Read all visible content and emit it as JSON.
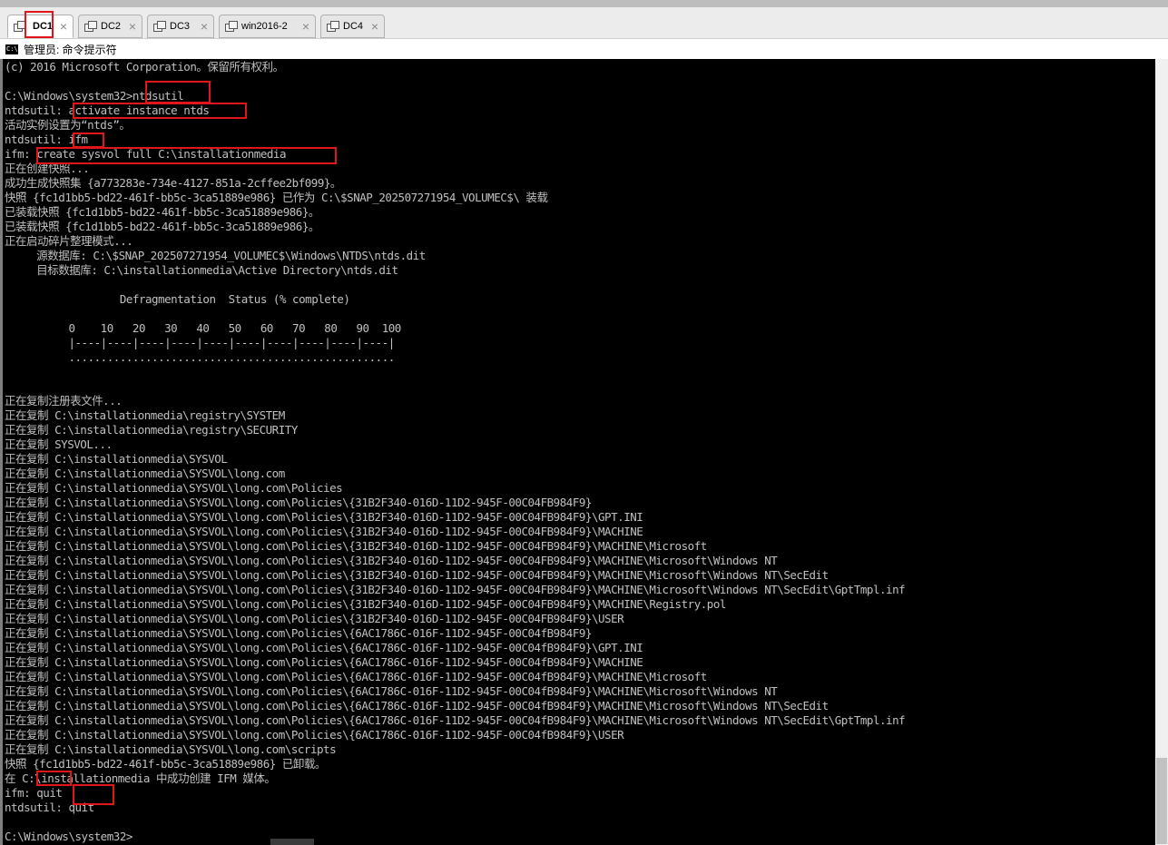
{
  "tabs": [
    {
      "label": "DC1",
      "active": true
    },
    {
      "label": "DC2",
      "active": false
    },
    {
      "label": "DC3",
      "active": false
    },
    {
      "label": "win2016-2",
      "active": false
    },
    {
      "label": "DC4",
      "active": false
    }
  ],
  "close_glyph": "×",
  "window": {
    "title": "管理员: 命令提示符",
    "icon_text": "C:\\"
  },
  "console_lines": [
    "(c) 2016 Microsoft Corporation。保留所有权利。",
    "",
    "C:\\Windows\\system32>ntdsutil",
    "ntdsutil: activate instance ntds",
    "活动实例设置为“ntds”。",
    "ntdsutil: ifm",
    "ifm: create sysvol full C:\\installationmedia",
    "正在创建快照...",
    "成功生成快照集 {a773283e-734e-4127-851a-2cffee2bf099}。",
    "快照 {fc1d1bb5-bd22-461f-bb5c-3ca51889e986} 已作为 C:\\$SNAP_202507271954_VOLUMEC$\\ 装载",
    "已装载快照 {fc1d1bb5-bd22-461f-bb5c-3ca51889e986}。",
    "已装载快照 {fc1d1bb5-bd22-461f-bb5c-3ca51889e986}。",
    "正在启动碎片整理模式...",
    "     源数据库: C:\\$SNAP_202507271954_VOLUMEC$\\Windows\\NTDS\\ntds.dit",
    "     目标数据库: C:\\installationmedia\\Active Directory\\ntds.dit",
    "",
    "                  Defragmentation  Status (% complete)",
    "",
    "          0    10   20   30   40   50   60   70   80   90  100",
    "          |----|----|----|----|----|----|----|----|----|----|",
    "          ...................................................",
    "",
    "",
    "正在复制注册表文件...",
    "正在复制 C:\\installationmedia\\registry\\SYSTEM",
    "正在复制 C:\\installationmedia\\registry\\SECURITY",
    "正在复制 SYSVOL...",
    "正在复制 C:\\installationmedia\\SYSVOL",
    "正在复制 C:\\installationmedia\\SYSVOL\\long.com",
    "正在复制 C:\\installationmedia\\SYSVOL\\long.com\\Policies",
    "正在复制 C:\\installationmedia\\SYSVOL\\long.com\\Policies\\{31B2F340-016D-11D2-945F-00C04FB984F9}",
    "正在复制 C:\\installationmedia\\SYSVOL\\long.com\\Policies\\{31B2F340-016D-11D2-945F-00C04FB984F9}\\GPT.INI",
    "正在复制 C:\\installationmedia\\SYSVOL\\long.com\\Policies\\{31B2F340-016D-11D2-945F-00C04FB984F9}\\MACHINE",
    "正在复制 C:\\installationmedia\\SYSVOL\\long.com\\Policies\\{31B2F340-016D-11D2-945F-00C04FB984F9}\\MACHINE\\Microsoft",
    "正在复制 C:\\installationmedia\\SYSVOL\\long.com\\Policies\\{31B2F340-016D-11D2-945F-00C04FB984F9}\\MACHINE\\Microsoft\\Windows NT",
    "正在复制 C:\\installationmedia\\SYSVOL\\long.com\\Policies\\{31B2F340-016D-11D2-945F-00C04FB984F9}\\MACHINE\\Microsoft\\Windows NT\\SecEdit",
    "正在复制 C:\\installationmedia\\SYSVOL\\long.com\\Policies\\{31B2F340-016D-11D2-945F-00C04FB984F9}\\MACHINE\\Microsoft\\Windows NT\\SecEdit\\GptTmpl.inf",
    "正在复制 C:\\installationmedia\\SYSVOL\\long.com\\Policies\\{31B2F340-016D-11D2-945F-00C04FB984F9}\\MACHINE\\Registry.pol",
    "正在复制 C:\\installationmedia\\SYSVOL\\long.com\\Policies\\{31B2F340-016D-11D2-945F-00C04FB984F9}\\USER",
    "正在复制 C:\\installationmedia\\SYSVOL\\long.com\\Policies\\{6AC1786C-016F-11D2-945F-00C04fB984F9}",
    "正在复制 C:\\installationmedia\\SYSVOL\\long.com\\Policies\\{6AC1786C-016F-11D2-945F-00C04fB984F9}\\GPT.INI",
    "正在复制 C:\\installationmedia\\SYSVOL\\long.com\\Policies\\{6AC1786C-016F-11D2-945F-00C04fB984F9}\\MACHINE",
    "正在复制 C:\\installationmedia\\SYSVOL\\long.com\\Policies\\{6AC1786C-016F-11D2-945F-00C04fB984F9}\\MACHINE\\Microsoft",
    "正在复制 C:\\installationmedia\\SYSVOL\\long.com\\Policies\\{6AC1786C-016F-11D2-945F-00C04fB984F9}\\MACHINE\\Microsoft\\Windows NT",
    "正在复制 C:\\installationmedia\\SYSVOL\\long.com\\Policies\\{6AC1786C-016F-11D2-945F-00C04fB984F9}\\MACHINE\\Microsoft\\Windows NT\\SecEdit",
    "正在复制 C:\\installationmedia\\SYSVOL\\long.com\\Policies\\{6AC1786C-016F-11D2-945F-00C04fB984F9}\\MACHINE\\Microsoft\\Windows NT\\SecEdit\\GptTmpl.inf",
    "正在复制 C:\\installationmedia\\SYSVOL\\long.com\\Policies\\{6AC1786C-016F-11D2-945F-00C04fB984F9}\\USER",
    "正在复制 C:\\installationmedia\\SYSVOL\\long.com\\scripts",
    "快照 {fc1d1bb5-bd22-461f-bb5c-3ca51889e986} 已卸载。",
    "在 C:\\installationmedia 中成功创建 IFM 媒体。",
    "ifm: quit",
    "ntdsutil: quit",
    "",
    "C:\\Windows\\system32>"
  ],
  "colors": {
    "console_bg": "#000000",
    "console_fg": "#c0c0c0",
    "highlight_border": "#e0161a"
  }
}
